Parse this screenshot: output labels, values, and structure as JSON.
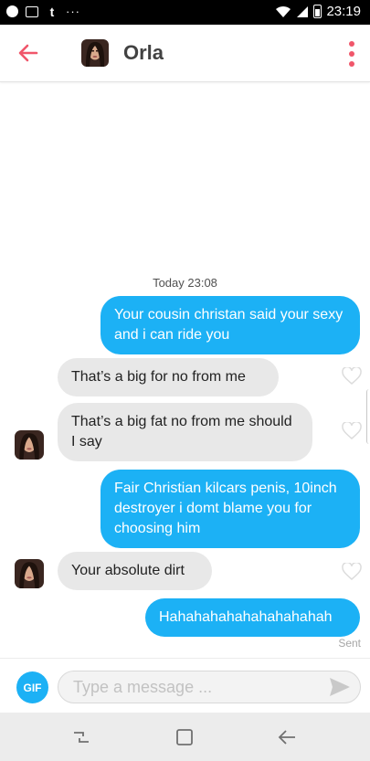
{
  "status_bar": {
    "time": "23:19",
    "left_icons": [
      "messenger-icon",
      "gallery-icon",
      "tumblr-icon",
      "more-dots-icon"
    ],
    "right_icons": [
      "wifi-icon",
      "signal-icon",
      "battery-icon"
    ],
    "dots": "···",
    "t": "t"
  },
  "header": {
    "name": "Orla",
    "accent_color": "#f0566a"
  },
  "chat": {
    "timestamp": "Today 23:08",
    "messages": [
      {
        "from": "me",
        "text": "Your cousin christan said your sexy and i can ride you"
      },
      {
        "from": "them",
        "text": "That’s a big for no from me"
      },
      {
        "from": "them",
        "text": "That’s a big fat no from me should I say"
      },
      {
        "from": "me",
        "text": "Fair  Christian kilcars penis, 10inch destroyer i domt blame you for choosing him"
      },
      {
        "from": "them",
        "text": "Your absolute dirt"
      },
      {
        "from": "me",
        "text": "Hahahahahahahahahahah"
      }
    ],
    "sent_label": "Sent",
    "outgoing_color": "#1cb1f5",
    "incoming_color": "#e8e8e8"
  },
  "composer": {
    "gif_label": "GIF",
    "placeholder": "Type a message ..."
  },
  "nav_bar": {
    "buttons": [
      "recent-apps-icon",
      "home-icon",
      "back-icon"
    ]
  }
}
